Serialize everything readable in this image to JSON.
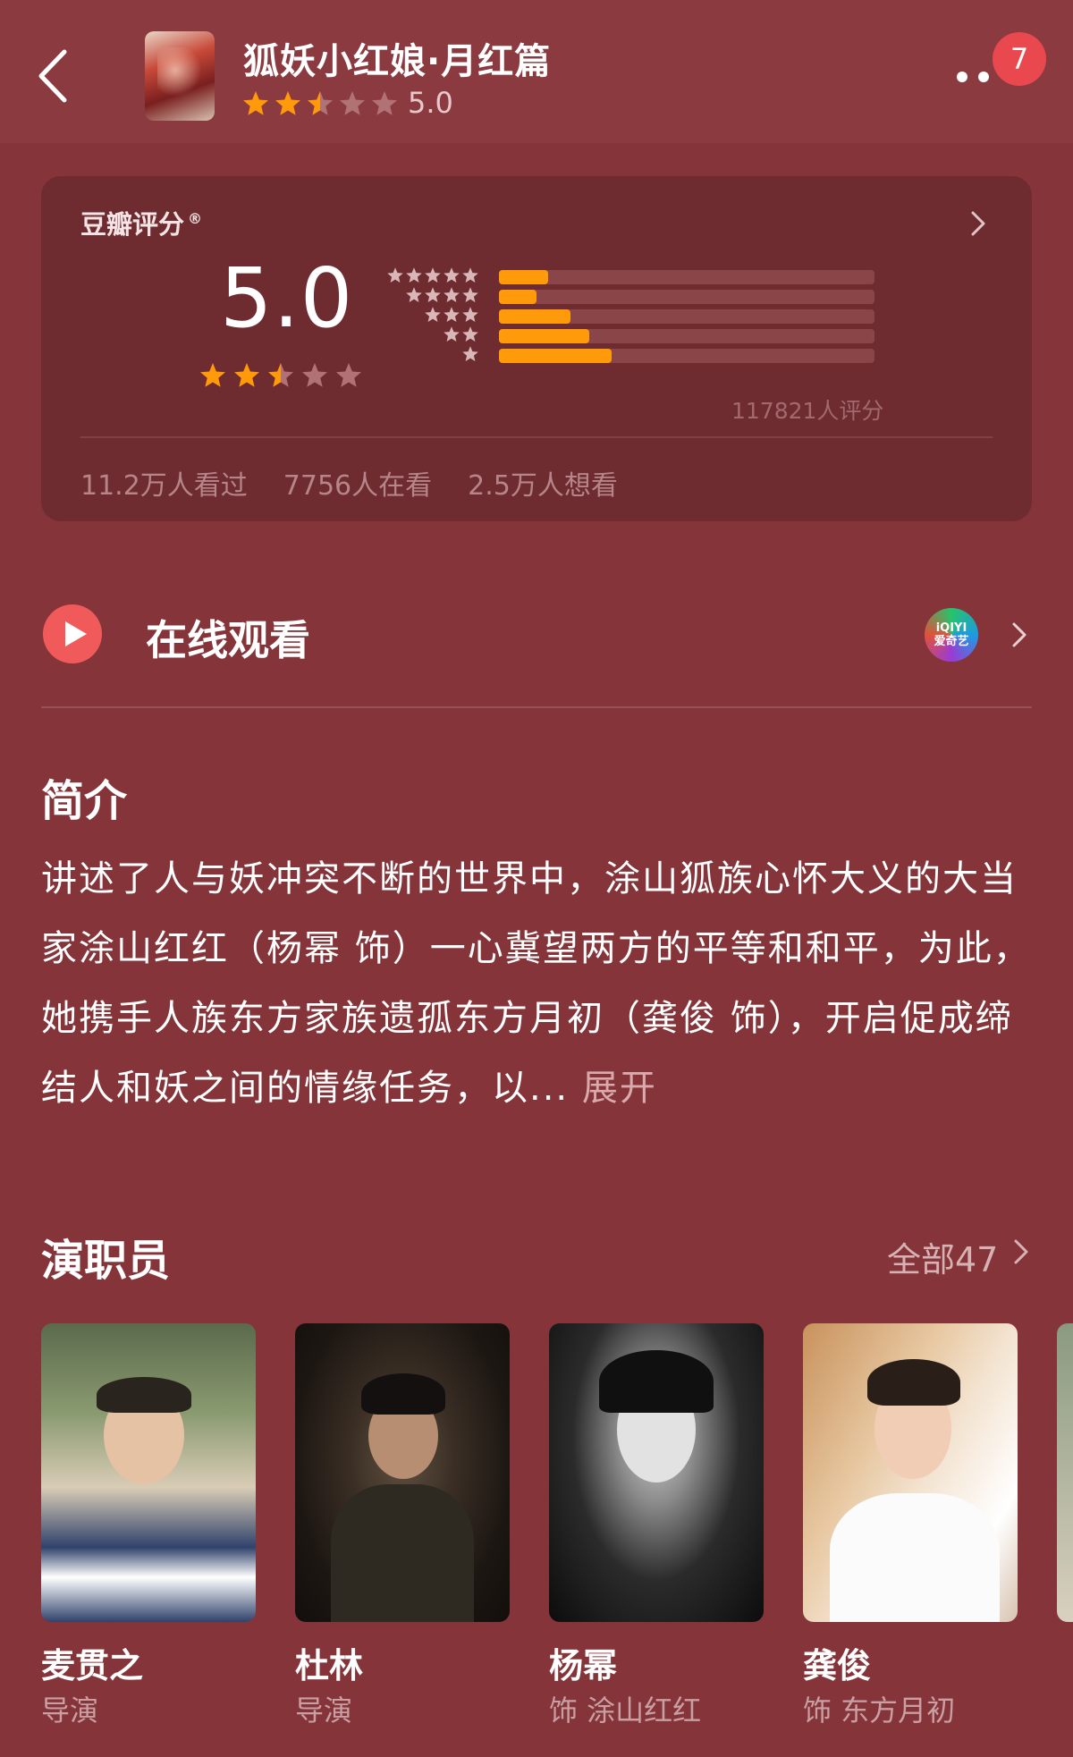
{
  "header": {
    "back_icon": "chevron-left-icon",
    "title": "狐妖小红娘·月红篇",
    "rating_text": "5.0",
    "rating_stars": 2.5,
    "more_icon": "more-dots-icon",
    "notification_count": "7"
  },
  "rating_card": {
    "title": "豆瓣评分",
    "registered": "®",
    "score": "5.0",
    "stars": 2.5,
    "distribution": [
      {
        "stars": 5,
        "fraction": 0.13
      },
      {
        "stars": 4,
        "fraction": 0.1
      },
      {
        "stars": 3,
        "fraction": 0.19
      },
      {
        "stars": 2,
        "fraction": 0.24
      },
      {
        "stars": 1,
        "fraction": 0.3
      }
    ],
    "rating_count": "117821人评分",
    "stats": [
      "11.2万人看过",
      "7756人在看",
      "2.5万人想看"
    ]
  },
  "watch": {
    "label": "在线观看",
    "provider_logo_text": "iQIYI",
    "provider_logo_sub": "爱奇艺"
  },
  "intro": {
    "heading": "简介",
    "text": "讲述了人与妖冲突不断的世界中，涂山狐族心怀大义的大当家涂山红红（杨幂 饰）一心冀望两方的平等和和平，为此，她携手人族东方家族遗孤东方月初（龚俊 饰），开启促成缔结人和妖之间的情缘任务，以...",
    "expand_label": "展开"
  },
  "cast": {
    "heading": "演职员",
    "all_label": "全部47",
    "members": [
      {
        "name": "麦贯之",
        "role": "导演"
      },
      {
        "name": "杜林",
        "role": "导演"
      },
      {
        "name": "杨幂",
        "role": "饰 涂山红红"
      },
      {
        "name": "龚俊",
        "role": "饰 东方月初"
      }
    ]
  },
  "colors": {
    "background": "#853439",
    "card": "#6e2c31",
    "star_filled": "#ff9a0a",
    "star_empty": "#b07275",
    "bar_fill": "#ff9a0a",
    "badge": "#e8484e",
    "play": "#f05a5a"
  }
}
